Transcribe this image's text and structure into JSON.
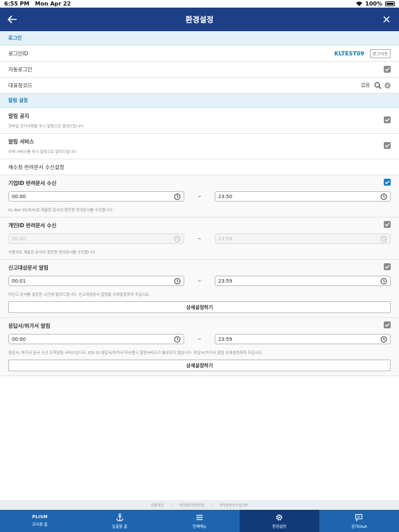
{
  "status_bar": {
    "time": "6:55 PM",
    "date": "Mon Apr 22",
    "battery": "100%"
  },
  "navbar": {
    "title": "환경설정"
  },
  "login_section": {
    "header": "로그인",
    "login_id_label": "로그인ID",
    "login_id_value": "KLTEST09",
    "logout_label": "로그아웃",
    "auto_login_label": "자동로그인",
    "rep_code_label": "대표청코드",
    "rep_code_value": "없음"
  },
  "alarm_section": {
    "header": "알림 설정",
    "notice_title": "알림 공지",
    "notice_desc": "모바일 공지사항을 푸시 알림으로 알려드립니다.",
    "service_title": "알림 서비스",
    "service_desc": "아래 서비스를 푸시 알림으로 알려드립니다.",
    "reject_header": "해수청 반려문서 수신설정"
  },
  "alarms": [
    {
      "title": "기업ID 반려문서 수신",
      "start": "00:00",
      "end": "23:50",
      "desc": "KL-Net ID(회사)로 제출한 문서의 항만청 반려문서를 수신합니다.",
      "checked": true,
      "disabled": false
    },
    {
      "title": "개인ID 반려문서 수신",
      "start": "00:00",
      "end": "23:59",
      "desc": "사용자로 제출한 문서의 항만청 반려문서를 수신합니다.",
      "checked": false,
      "disabled": true
    },
    {
      "title": "신고대상문서 알림",
      "start": "00:01",
      "end": "23:59",
      "desc": "미신고 문서를 설정한 시간에 알려드립니다. 신고대상문서 알림을 상세설정하여 주십시오.",
      "button": "상세설정하기",
      "checked": false,
      "disabled": false
    },
    {
      "title": "응답서/허가서 알림",
      "start": "00:00",
      "end": "23:59",
      "desc": "응답서, 허가서 문서 수신 도착알림 서비스입니다. EDI ID 응답서/허가서 미사용시 알림서비스가 통보되지 않습니다. 응답서/허가서 알림 상세설정하여 주십시오.",
      "button": "상세설정하기",
      "checked": false,
      "disabled": false
    }
  ],
  "time_separator": "~",
  "footer_links": [
    "이용약관",
    "개인정보처리방침",
    "저작권무단수집거부"
  ],
  "tabs": [
    {
      "label": "프리즘 홈",
      "icon": "plism-icon",
      "logo_text": "PLISM"
    },
    {
      "label": "입출항 홈",
      "icon": "anchor-icon"
    },
    {
      "label": "전체메뉴",
      "icon": "menu-icon"
    },
    {
      "label": "환경설정",
      "icon": "gear-icon",
      "active": true
    },
    {
      "label": "공지Q&A",
      "icon": "chat-icon"
    }
  ],
  "colors": {
    "nav": "#1c3f86",
    "tabbar": "#1e65b0",
    "tab_active": "#103a78",
    "accent": "#1a7ab5",
    "check_on": "#1c7cc4"
  }
}
